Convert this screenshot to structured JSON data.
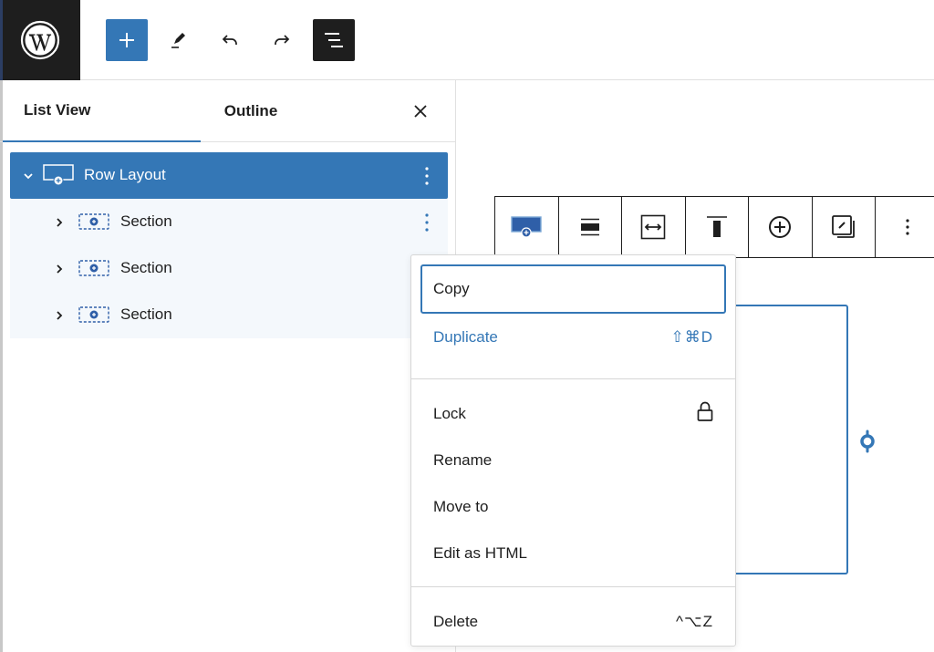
{
  "topbar": {
    "logo": "wordpress-logo",
    "buttons": [
      {
        "name": "add-block",
        "icon": "plus-icon",
        "active": true
      },
      {
        "name": "tools",
        "icon": "pencil-icon"
      },
      {
        "name": "undo",
        "icon": "undo-icon"
      },
      {
        "name": "redo",
        "icon": "redo-icon"
      },
      {
        "name": "document-overview",
        "icon": "list-view-icon",
        "active": true
      }
    ]
  },
  "sidebar": {
    "tabs": [
      {
        "label": "List View",
        "active": true
      },
      {
        "label": "Outline",
        "active": false
      }
    ],
    "close_icon": "close-icon",
    "tree": [
      {
        "label": "Row Layout",
        "icon": "row-layout-icon",
        "expanded": true,
        "selected": true,
        "level": 1
      },
      {
        "label": "Section",
        "icon": "section-icon",
        "expanded": false,
        "level": 2,
        "show_options": true
      },
      {
        "label": "Section",
        "icon": "section-icon",
        "expanded": false,
        "level": 2
      },
      {
        "label": "Section",
        "icon": "section-icon",
        "expanded": false,
        "level": 2
      }
    ]
  },
  "block_toolbar": {
    "buttons": [
      {
        "name": "block-type",
        "icon": "row-layout-icon"
      },
      {
        "name": "align",
        "icon": "align-full-icon"
      },
      {
        "name": "width",
        "icon": "stretch-width-icon"
      },
      {
        "name": "vertical-align",
        "icon": "vertical-align-top-icon"
      },
      {
        "name": "add-section",
        "icon": "plus-circle-icon"
      },
      {
        "name": "styles",
        "icon": "styles-copy-icon"
      },
      {
        "name": "more-options",
        "icon": "more-vertical-icon"
      }
    ]
  },
  "context_menu": {
    "groups": [
      [
        {
          "label": "Copy",
          "focused": true
        },
        {
          "label": "Duplicate",
          "shortcut": "⇧⌘D",
          "highlight": true
        }
      ],
      [
        {
          "label": "Lock",
          "icon": "lock-icon"
        },
        {
          "label": "Rename"
        },
        {
          "label": "Move to"
        },
        {
          "label": "Edit as HTML"
        }
      ],
      [
        {
          "label": "Delete",
          "shortcut": "^⌥Z"
        }
      ]
    ]
  },
  "colors": {
    "accent": "#3477b6",
    "dark": "#1e1e1e",
    "child_row_bg": "#f4f8fc",
    "border": "#e0e0e0"
  }
}
